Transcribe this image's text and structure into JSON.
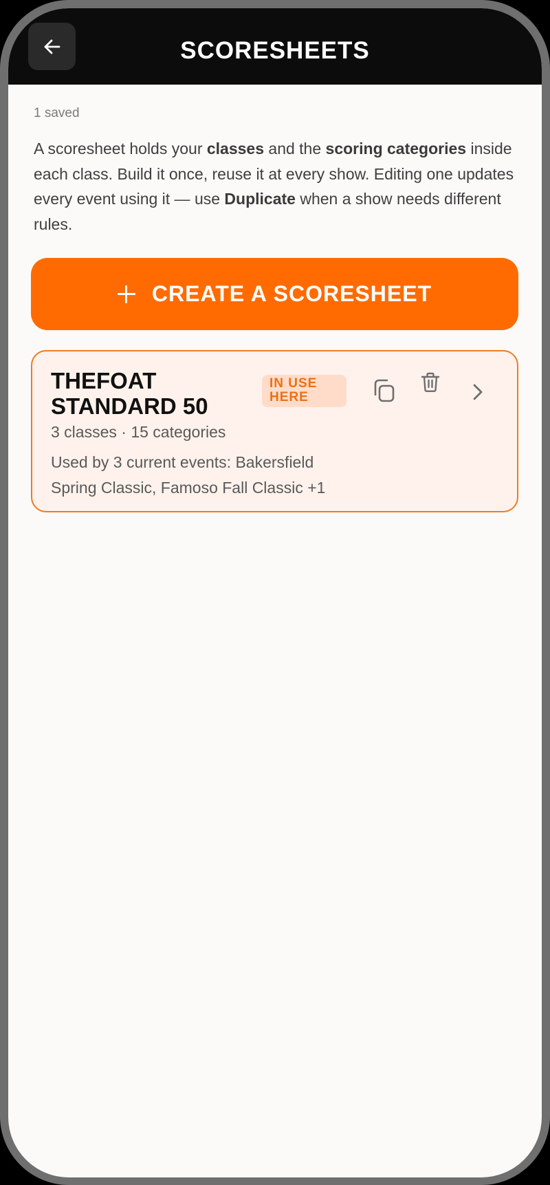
{
  "header": {
    "title": "SCORESHEETS",
    "back_icon": "arrow-left-icon"
  },
  "summary": {
    "saved_count": "1 saved"
  },
  "intro": {
    "part1": "A scoresheet holds your ",
    "bold1": "classes",
    "part2": " and the ",
    "bold2": "scoring categories",
    "part3": " inside each class. Build it once, reuse it at every show. Editing one updates every event using it — use ",
    "bold3": "Duplicate",
    "part4": " when a show needs different rules."
  },
  "actions": {
    "create_label": "CREATE A SCORESHEET",
    "create_icon": "plus-icon"
  },
  "scoresheets": [
    {
      "name": "THEFOAT STANDARD 50",
      "badge": "IN USE HERE",
      "meta": "3 classes · 15 categories",
      "usage": "Used by 3 current events: Bakersfield Spring Classic, Famoso Fall Classic +1",
      "icons": [
        "copy-icon",
        "trash-icon",
        "chevron-right-icon"
      ]
    }
  ],
  "colors": {
    "accent": "#ff6b00",
    "header_bg": "#0c0c0c",
    "card_bg": "#fff2ec",
    "card_border": "#f07a1f",
    "badge_bg": "#ffdcc9",
    "badge_text": "#ee6f12",
    "page_bg": "#fbfaf8"
  }
}
